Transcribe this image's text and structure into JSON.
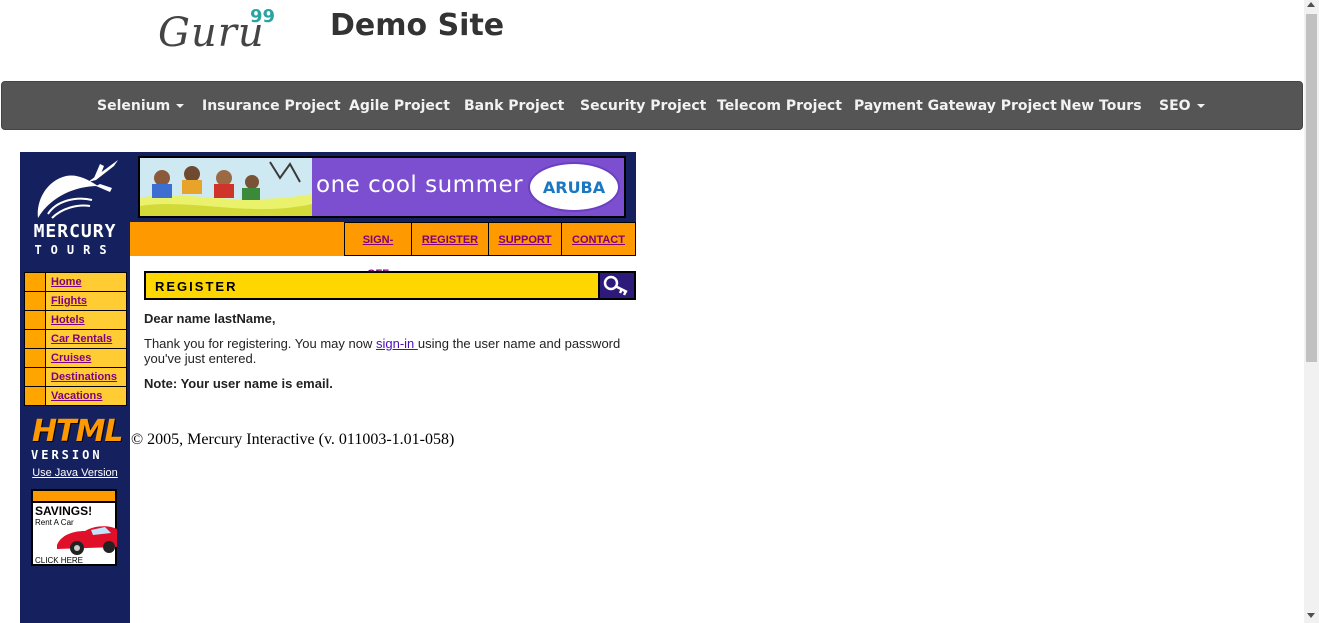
{
  "header": {
    "logo_text": "Guru",
    "logo_sup": "99",
    "site_title": "Demo Site"
  },
  "navbar": {
    "items": [
      {
        "label": "Selenium",
        "dropdown": true
      },
      {
        "label": "Insurance Project",
        "dropdown": false
      },
      {
        "label": "Agile Project",
        "dropdown": false
      },
      {
        "label": "Bank Project",
        "dropdown": false
      },
      {
        "label": "Security Project",
        "dropdown": false
      },
      {
        "label": "Telecom Project",
        "dropdown": false
      },
      {
        "label": "Payment Gateway Project",
        "dropdown": false
      },
      {
        "label": "New Tours",
        "dropdown": false
      },
      {
        "label": "SEO",
        "dropdown": true
      }
    ]
  },
  "sidebar": {
    "brand": "MERCURY",
    "brand_sub": "TOURS",
    "menu": [
      "Home",
      "Flights",
      "Hotels",
      "Car Rentals",
      "Cruises",
      "Destinations",
      "Vacations"
    ],
    "html_big": "HTML",
    "html_small": "VERSION",
    "java_link": "Use Java Version",
    "ad": {
      "title": "SAVINGS!",
      "subtitle": "Rent A Car",
      "cta": "CLICK HERE"
    }
  },
  "banner": {
    "text": "one cool summer",
    "brand": "ARUBA"
  },
  "top_nav": [
    "SIGN-OFF",
    "REGISTER",
    "SUPPORT",
    "CONTACT"
  ],
  "register": {
    "title": "REGISTER",
    "greeting": "Dear name lastName,",
    "message_before": "Thank you for registering. You may now ",
    "signin_link": "sign-in ",
    "message_after": "using the user name and password you've just entered.",
    "note": "Note: Your user name is email."
  },
  "footer": "© 2005, Mercury Interactive (v. 011003-1.01-058)",
  "colors": {
    "navbar_bg": "#555555",
    "mercury_navy": "#15215e",
    "orange": "#ff9900",
    "gold": "#ffd700",
    "link_purple": "#800080"
  }
}
